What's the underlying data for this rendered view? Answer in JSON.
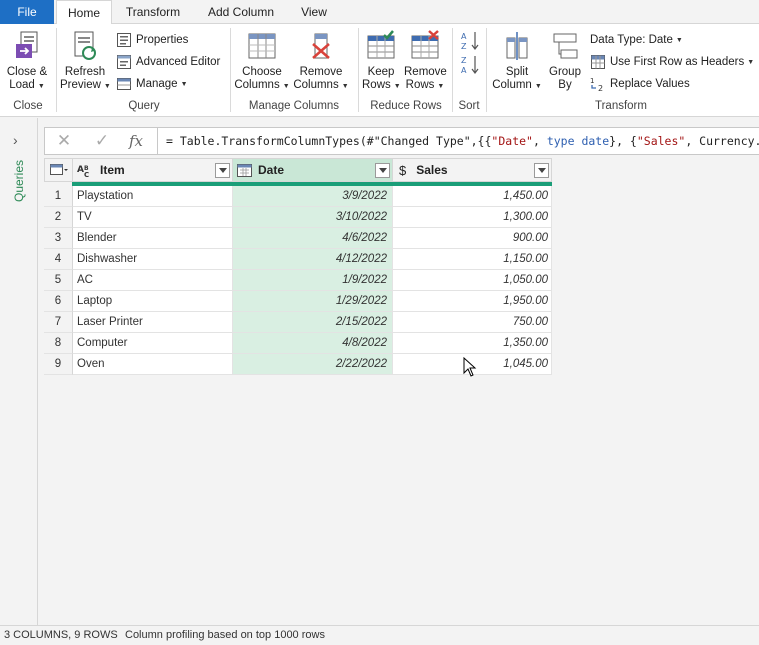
{
  "tabs": [
    "File",
    "Home",
    "Transform",
    "Add Column",
    "View"
  ],
  "ribbon": {
    "close": {
      "close_load": "Close &",
      "close_load2": "Load",
      "group_label": "Close"
    },
    "query": {
      "refresh": "Refresh",
      "refresh2": "Preview",
      "properties": "Properties",
      "advanced_editor": "Advanced Editor",
      "manage": "Manage",
      "group_label": "Query"
    },
    "manage_columns": {
      "choose": "Choose",
      "choose2": "Columns",
      "remove": "Remove",
      "remove2": "Columns",
      "group_label": "Manage Columns"
    },
    "reduce_rows": {
      "keep": "Keep",
      "keep2": "Rows",
      "remove": "Remove",
      "remove2": "Rows",
      "group_label": "Reduce Rows"
    },
    "sort": {
      "group_label": "Sort"
    },
    "transform": {
      "split": "Split",
      "split2": "Column",
      "group_by": "Group",
      "group_by2": "By",
      "data_type": "Data Type: Date",
      "first_row": "Use First Row as Headers",
      "replace": "Replace Values",
      "group_label": "Transform"
    }
  },
  "queries_label": "Queries",
  "formula": {
    "prefix": "= Table.TransformColumnTypes(#\"Changed Type\",{{",
    "s1": "\"Date\"",
    "comma1": ", ",
    "kw1": "type date",
    "mid": "}, {",
    "s2": "\"Sales\"",
    "rest": ", Currency.Type"
  },
  "columns": [
    {
      "name": "Item",
      "type": "text"
    },
    {
      "name": "Date",
      "type": "date"
    },
    {
      "name": "Sales",
      "type": "currency"
    }
  ],
  "rows": [
    {
      "n": "1",
      "item": "Playstation",
      "date": "3/9/2022",
      "sales": "1,450.00"
    },
    {
      "n": "2",
      "item": "TV",
      "date": "3/10/2022",
      "sales": "1,300.00"
    },
    {
      "n": "3",
      "item": "Blender",
      "date": "4/6/2022",
      "sales": "900.00"
    },
    {
      "n": "4",
      "item": "Dishwasher",
      "date": "4/12/2022",
      "sales": "1,150.00"
    },
    {
      "n": "5",
      "item": "AC",
      "date": "1/9/2022",
      "sales": "1,050.00"
    },
    {
      "n": "6",
      "item": "Laptop",
      "date": "1/29/2022",
      "sales": "1,950.00"
    },
    {
      "n": "7",
      "item": "Laser Printer",
      "date": "2/15/2022",
      "sales": "750.00"
    },
    {
      "n": "8",
      "item": "Computer",
      "date": "4/8/2022",
      "sales": "1,350.00"
    },
    {
      "n": "9",
      "item": "Oven",
      "date": "2/22/2022",
      "sales": "1,045.00"
    }
  ],
  "status": {
    "summary": "3 COLUMNS, 9 ROWS",
    "profiling": "Column profiling based on top 1000 rows"
  }
}
